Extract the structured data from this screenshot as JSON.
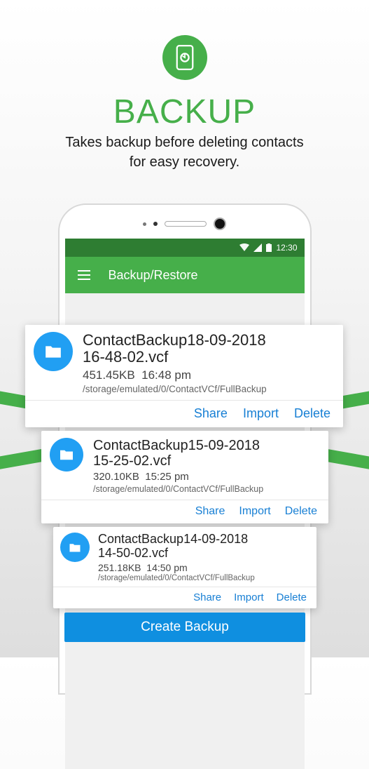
{
  "hero": {
    "title": "Backup",
    "subtitle_line1": "Takes backup before deleting contacts",
    "subtitle_line2": "for easy recovery."
  },
  "status_bar": {
    "time": "12:30"
  },
  "app_bar": {
    "title": "Backup/Restore"
  },
  "cards": [
    {
      "filename_line1": "ContactBackup18-09-2018",
      "filename_line2": "16-48-02.vcf",
      "size": "451.45KB",
      "time": "16:48 pm",
      "path": "/storage/emulated/0/ContactVCf/FullBackup"
    },
    {
      "filename_line1": "ContactBackup15-09-2018",
      "filename_line2": "15-25-02.vcf",
      "size": "320.10KB",
      "time": "15:25 pm",
      "path": "/storage/emulated/0/ContactVCf/FullBackup"
    },
    {
      "filename_line1": "ContactBackup14-09-2018",
      "filename_line2": "14-50-02.vcf",
      "size": "251.18KB",
      "time": "14:50 pm",
      "path": "/storage/emulated/0/ContactVCf/FullBackup"
    }
  ],
  "action_labels": {
    "share": "Share",
    "import": "Import",
    "delete": "Delete"
  },
  "create_button": "Create Backup"
}
